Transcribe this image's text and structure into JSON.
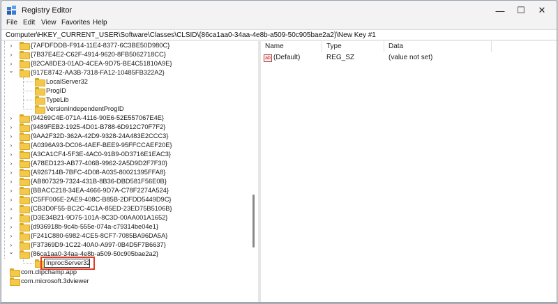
{
  "window": {
    "title": "Registry Editor",
    "minimize": "—",
    "maximize": "☐",
    "close": "✕"
  },
  "menu": [
    "File",
    "Edit",
    "View",
    "Favorites",
    "Help"
  ],
  "address": "Computer\\HKEY_CURRENT_USER\\Software\\Classes\\CLSID\\{86ca1aa0-34aa-4e8b-a509-50c905bae2a2}\\New Key #1",
  "tree": [
    {
      "label": "{7AFDFDDB-F914-11E4-8377-6C3BE50D980C}",
      "level": 1,
      "expander": "collapsed"
    },
    {
      "label": "{7B37E4E2-C62F-4914-9620-8FB5062718CC}",
      "level": 1,
      "expander": "collapsed"
    },
    {
      "label": "{82CA8DE3-01AD-4CEA-9D75-BE4C51810A9E}",
      "level": 1,
      "expander": "collapsed"
    },
    {
      "label": "{917E8742-AA3B-7318-FA12-10485FB322A2}",
      "level": 1,
      "expander": "expanded"
    },
    {
      "label": "LocalServer32",
      "level": 2,
      "expander": "none"
    },
    {
      "label": "ProgID",
      "level": 2,
      "expander": "none"
    },
    {
      "label": "TypeLib",
      "level": 2,
      "expander": "none"
    },
    {
      "label": "VersionIndependentProgID",
      "level": 2,
      "expander": "none"
    },
    {
      "label": "{94269C4E-071A-4116-90E6-52E557067E4E}",
      "level": 1,
      "expander": "collapsed"
    },
    {
      "label": "{9489FEB2-1925-4D01-B788-6D912C70F7F2}",
      "level": 1,
      "expander": "collapsed"
    },
    {
      "label": "{9AA2F32D-362A-42D9-9328-24A483E2CCC3}",
      "level": 1,
      "expander": "collapsed"
    },
    {
      "label": "{A0396A93-DC06-4AEF-BEE9-95FFCCAEF20E}",
      "level": 1,
      "expander": "collapsed"
    },
    {
      "label": "{A3CA1CF4-5F3E-4AC0-91B9-0D3716E1EAC3}",
      "level": 1,
      "expander": "collapsed"
    },
    {
      "label": "{A78ED123-AB77-406B-9962-2A5D9D2F7F30}",
      "level": 1,
      "expander": "collapsed"
    },
    {
      "label": "{A926714B-7BFC-4D08-A035-80021395FFA8}",
      "level": 1,
      "expander": "collapsed"
    },
    {
      "label": "{AB807329-7324-431B-8B36-DBD581F56E0B}",
      "level": 1,
      "expander": "collapsed"
    },
    {
      "label": "{BBACC218-34EA-4666-9D7A-C78F2274A524}",
      "level": 1,
      "expander": "collapsed"
    },
    {
      "label": "{C5FF006E-2AE9-408C-B85B-2DFDD5449D9C}",
      "level": 1,
      "expander": "collapsed"
    },
    {
      "label": "{CB3D0F55-BC2C-4C1A-85ED-23ED75B5106B}",
      "level": 1,
      "expander": "collapsed"
    },
    {
      "label": "{D3E34B21-9D75-101A-8C3D-00AA001A1652}",
      "level": 1,
      "expander": "collapsed"
    },
    {
      "label": "{d936918b-9c4b-555e-074a-c79314be04e1}",
      "level": 1,
      "expander": "collapsed"
    },
    {
      "label": "{F241C880-6982-4CE5-8CF7-7085BA96DA5A}",
      "level": 1,
      "expander": "collapsed"
    },
    {
      "label": "{F37369D9-1C22-40A0-A997-0B4D5F7B6637}",
      "level": 1,
      "expander": "collapsed"
    },
    {
      "label": "{86ca1aa0-34aa-4e8b-a509-50c905bae2a2}",
      "level": 1,
      "expander": "expanded"
    },
    {
      "label": "InprocServer32",
      "level": 2,
      "expander": "none",
      "editing": true
    },
    {
      "label": "com.clipchamp.app",
      "level": 0,
      "expander": "none"
    },
    {
      "label": "com.microsoft.3dviewer",
      "level": 0,
      "expander": "none"
    }
  ],
  "values": {
    "columns": [
      "Name",
      "Type",
      "Data"
    ],
    "rows": [
      {
        "name": "(Default)",
        "type": "REG_SZ",
        "data": "(value not set)",
        "icon": "ab-string-icon"
      }
    ]
  },
  "colors": {
    "highlight_box": "#e23b26",
    "folder": "#f4c84a"
  }
}
